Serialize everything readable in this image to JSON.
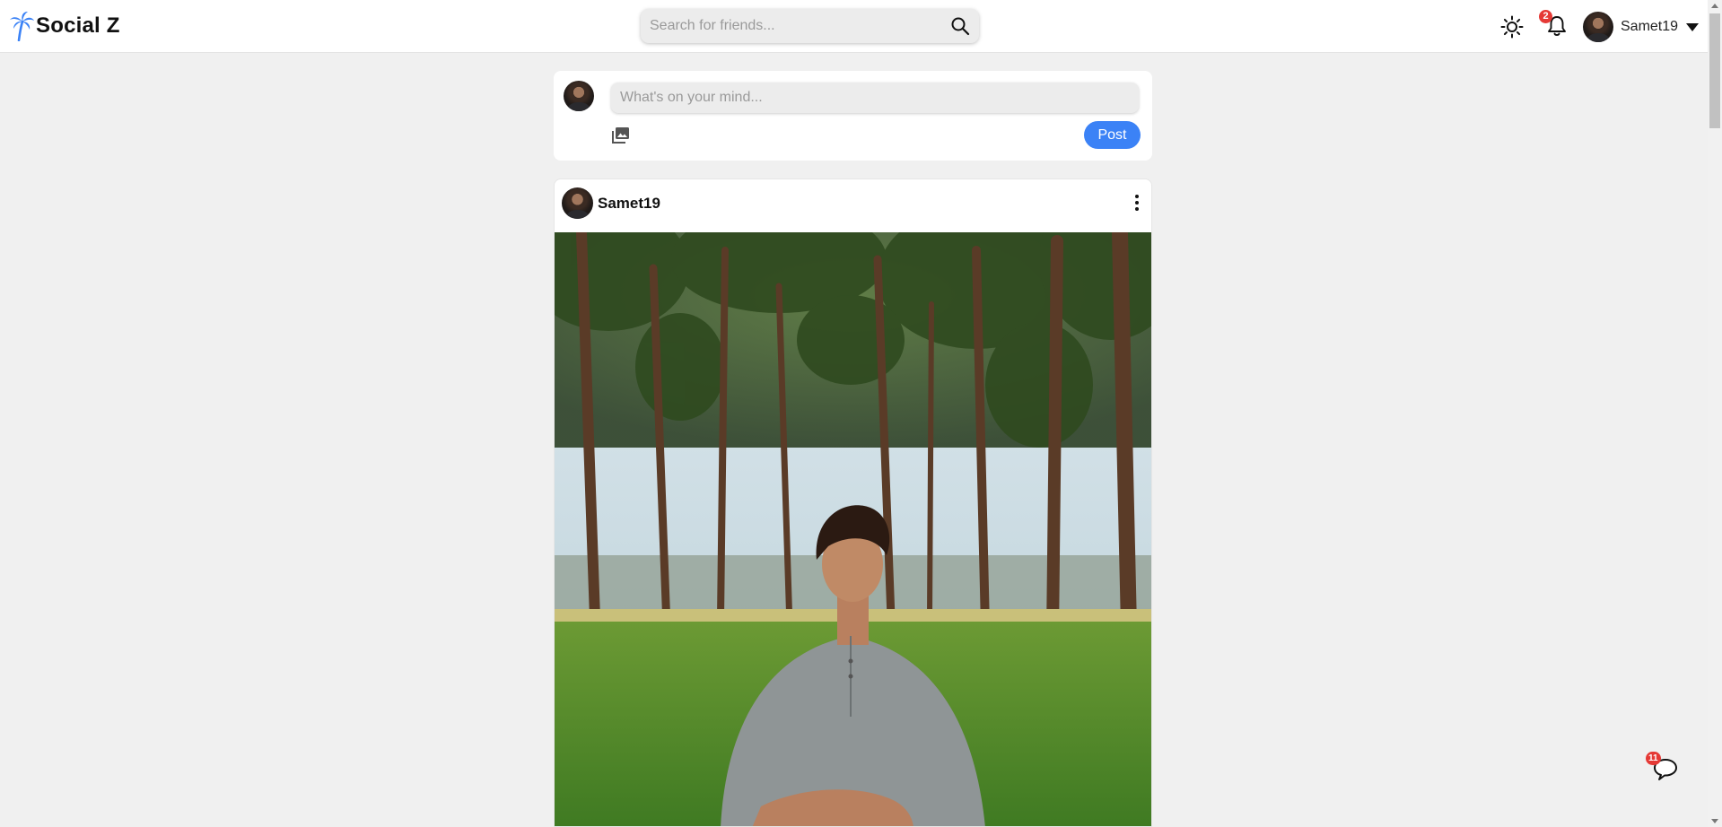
{
  "header": {
    "brand_name": "Social Z",
    "logo_icon": "palm-tree-icon",
    "brand_color": "#3b82f6",
    "search": {
      "placeholder": "Search for friends...",
      "value": "",
      "icon": "search-icon"
    },
    "theme_toggle_icon": "sun-icon",
    "notifications": {
      "icon": "bell-icon",
      "count": "2"
    },
    "user": {
      "name": "Samet19",
      "menu_icon": "caret-down-icon"
    }
  },
  "composer": {
    "placeholder": "What's on your mind...",
    "value": "",
    "photo_icon": "photo-library-icon",
    "post_label": "Post",
    "post_button_color": "#3b82f6"
  },
  "feed": {
    "posts": [
      {
        "author": "Samet19",
        "more_icon": "more-vertical-icon",
        "image_alt": "Young man sitting on grass in a park with tall pine trees"
      }
    ]
  },
  "chat": {
    "icon": "chat-bubble-icon",
    "unread_count": "11"
  },
  "colors": {
    "badge": "#e53935",
    "page_background": "#f0f0f0"
  }
}
